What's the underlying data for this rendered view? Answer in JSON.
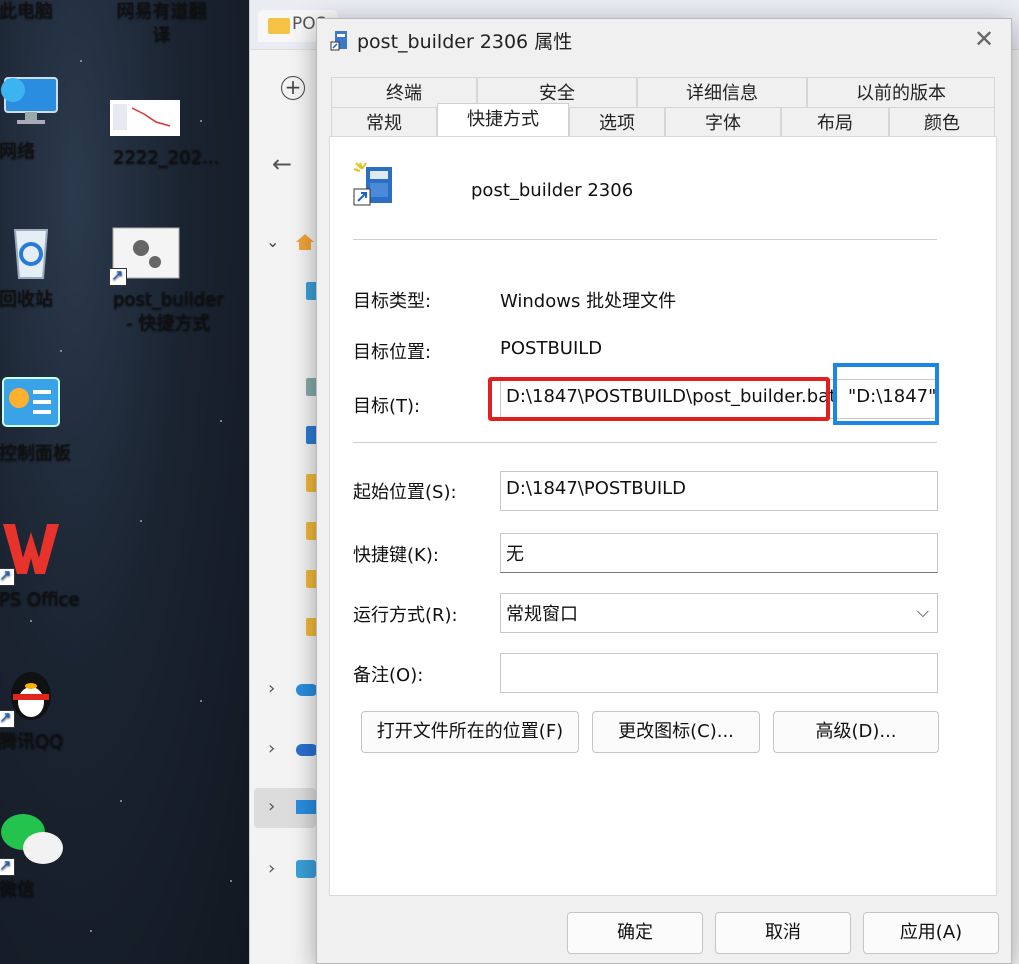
{
  "desktop": {
    "icons": [
      {
        "label": "此电脑"
      },
      {
        "label": "网易有道翻译"
      },
      {
        "label": "网络"
      },
      {
        "label": "2222_202..."
      },
      {
        "label": "回收站"
      },
      {
        "label": "post_builder\n- 快捷方式"
      },
      {
        "label": "控制面板"
      },
      {
        "label": "PS Office"
      },
      {
        "label": "腾讯QQ"
      },
      {
        "label": "微信"
      }
    ]
  },
  "explorer": {
    "tab_title": "POS"
  },
  "dialog": {
    "title": "post_builder 2306 属性",
    "close_glyph": "✕",
    "tabs_row1": [
      "终端",
      "安全",
      "详细信息",
      "以前的版本"
    ],
    "tabs_row2": [
      "常规",
      "快捷方式",
      "选项",
      "字体",
      "布局",
      "颜色"
    ],
    "active_tab": "快捷方式",
    "shortcut_name": "post_builder 2306",
    "target_type_label": "目标类型:",
    "target_type_value": "Windows 批处理文件",
    "target_location_label": "目标位置:",
    "target_location_value": "POSTBUILD",
    "target_label": "目标(T):",
    "target_value_part1": "D:\\1847\\POSTBUILD\\post_builder.bat",
    "target_value_part2": "\"D:\\1847\"",
    "start_in_label": "起始位置(S):",
    "start_in_value": "D:\\1847\\POSTBUILD",
    "hotkey_label": "快捷键(K):",
    "hotkey_value": "无",
    "run_label": "运行方式(R):",
    "run_value": "常规窗口",
    "comment_label": "备注(O):",
    "comment_value": "",
    "btn_open_location": "打开文件所在的位置(F)",
    "btn_change_icon": "更改图标(C)...",
    "btn_advanced": "高级(D)...",
    "btn_ok": "确定",
    "btn_cancel": "取消",
    "btn_apply": "应用(A)"
  },
  "colors": {
    "highlight_red": "#e0201e",
    "highlight_blue": "#1b86e3"
  },
  "icons": [
    "computer-icon",
    "network-icon",
    "recycle-bin-icon",
    "control-panel-icon",
    "wps-icon",
    "qq-icon",
    "wechat-icon",
    "batch-file-icon",
    "folder-icon",
    "home-icon",
    "back-arrow-icon",
    "plus-icon",
    "chevron-down-icon",
    "chevron-right-icon"
  ]
}
